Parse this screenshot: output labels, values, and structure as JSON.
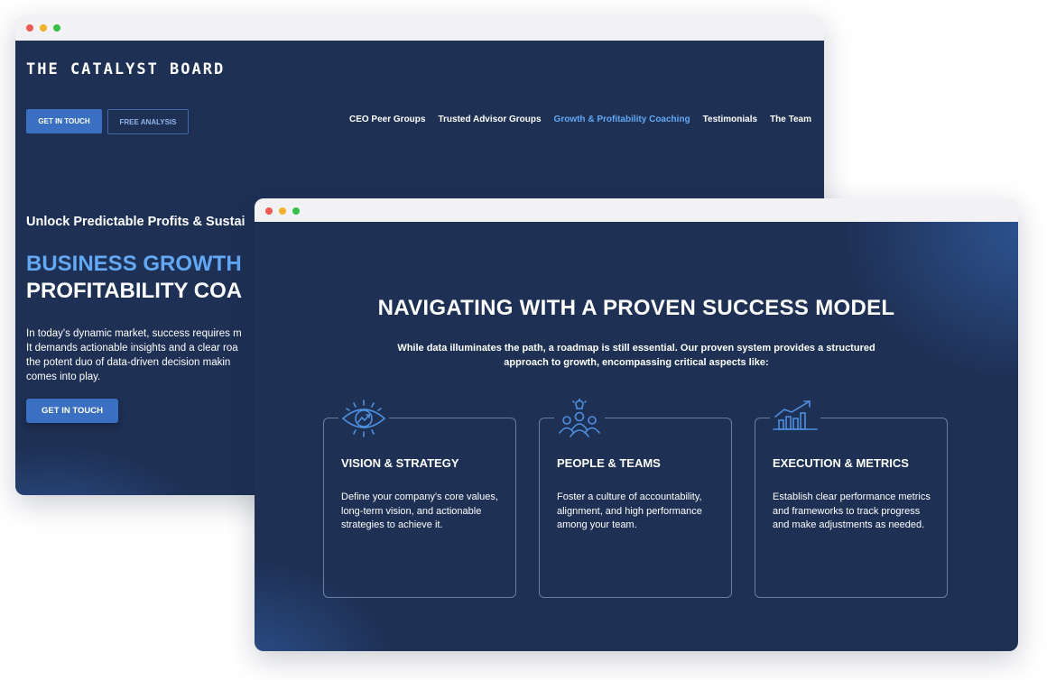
{
  "back_window": {
    "brand": "THE CATALYST BOARD",
    "buttons": {
      "get_in_touch": "GET IN TOUCH",
      "free_analysis": "FREE ANALYSIS"
    },
    "nav": [
      {
        "label": "CEO Peer Groups",
        "active": false
      },
      {
        "label": "Trusted Advisor Groups",
        "active": false
      },
      {
        "label": "Growth & Profitability Coaching",
        "active": true
      },
      {
        "label": "Testimonials",
        "active": false
      },
      {
        "label": "The Team",
        "active": false
      }
    ],
    "hero": {
      "eyebrow": "Unlock Predictable Profits & Sustai",
      "title_line1": "BUSINESS GROWTH",
      "title_line2": "PROFITABILITY COA",
      "body_lines": [
        "In today's dynamic market, success requires m",
        "It demands actionable insights and a clear roa",
        "the potent duo of data-driven decision makin",
        "comes into play."
      ],
      "cta": "GET IN TOUCH"
    }
  },
  "front_window": {
    "title": "NAVIGATING WITH A PROVEN SUCCESS MODEL",
    "subtitle": "While data illuminates the path, a roadmap is still essential. Our proven system provides a structured approach to growth, encompassing critical aspects like:",
    "cards": [
      {
        "icon": "eye-growth-icon",
        "title": "VISION & STRATEGY",
        "body": "Define your company's core values, long-term vision, and actionable strategies to achieve it."
      },
      {
        "icon": "team-idea-icon",
        "title": "PEOPLE & TEAMS",
        "body": "Foster a culture of accountability, alignment, and high performance among your team."
      },
      {
        "icon": "bar-chart-growth-icon",
        "title": "EXECUTION & METRICS",
        "body": "Establish clear performance metrics and frameworks to track progress and make adjustments as needed."
      }
    ]
  },
  "colors": {
    "navy_background": "#1e3054",
    "accent_blue": "#62a8f5",
    "button_blue": "#3a6fc2"
  }
}
